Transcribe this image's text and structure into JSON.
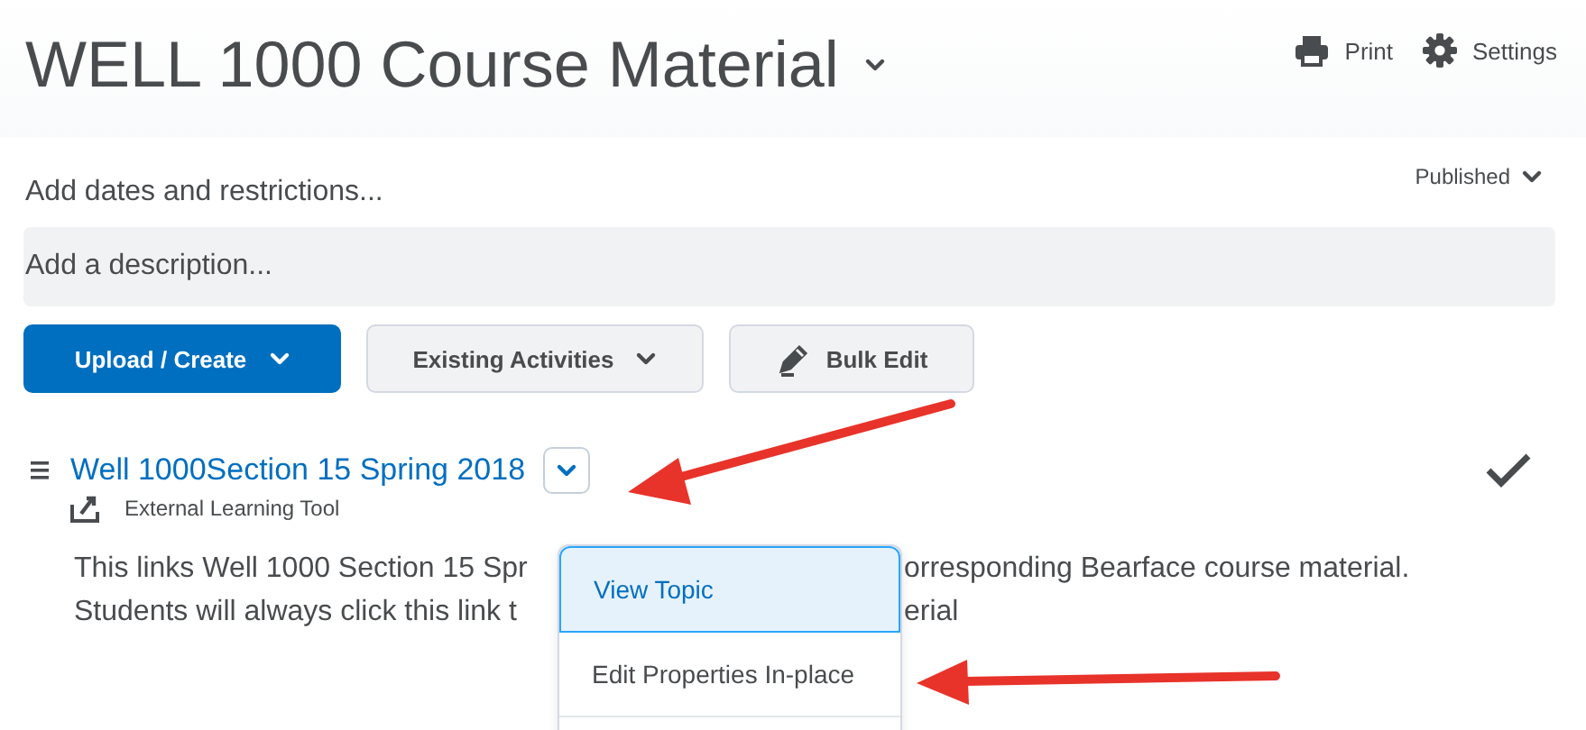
{
  "header": {
    "title": "WELL 1000 Course Material",
    "actions": [
      {
        "kind": "print",
        "label": "Print"
      },
      {
        "kind": "settings",
        "label": "Settings"
      }
    ]
  },
  "dates_link": "Add dates and restrictions...",
  "status": {
    "label": "Published"
  },
  "description_placeholder": "Add a description...",
  "buttons": [
    {
      "kind": "primary",
      "label": "Upload / Create",
      "dropdown": true
    },
    {
      "kind": "secondary",
      "label": "Existing Activities",
      "dropdown": true
    },
    {
      "kind": "edit",
      "label": "Bulk Edit",
      "dropdown": false
    }
  ],
  "topic": {
    "title": "Well 1000Section 15 Spring 2018",
    "type": "External Learning Tool",
    "completed": true,
    "description_lines": [
      {
        "left": "This links Well 1000 Section 15 Spr",
        "right": "orresponding Bearface course material."
      },
      {
        "left": "Students will always click this link t",
        "right": "erial"
      }
    ]
  },
  "menu": {
    "items": [
      {
        "label": "View Topic",
        "selected": true
      },
      {
        "label": "Edit Properties In-place",
        "selected": false
      }
    ]
  }
}
